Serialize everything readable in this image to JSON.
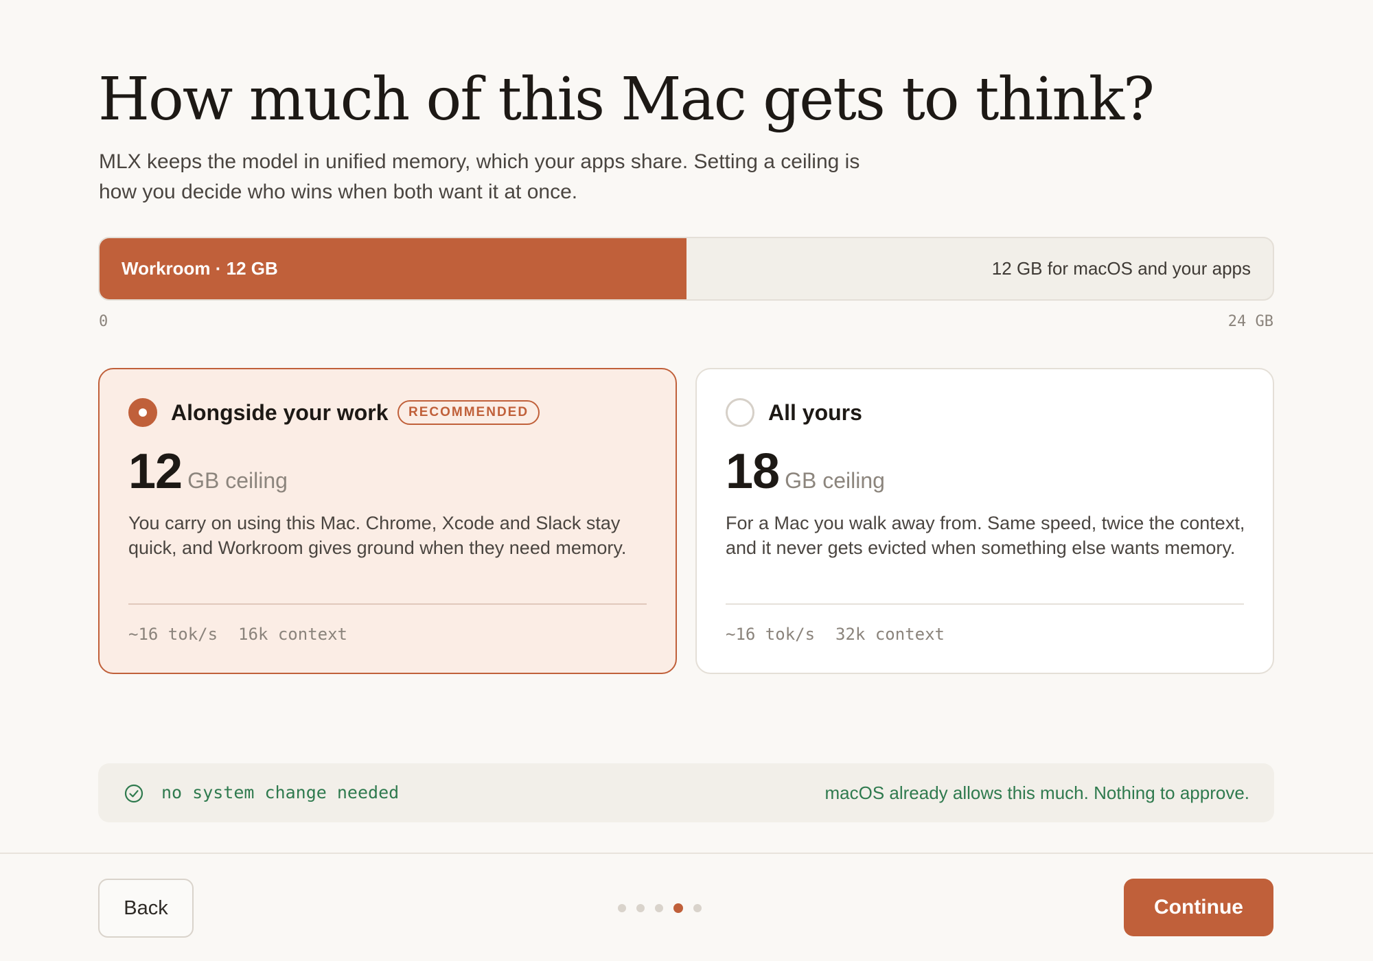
{
  "header": {
    "title": "How much of this Mac gets to think?",
    "subtitle": "MLX keeps the model in unified memory, which your apps share. Setting a ceiling is how you decide who wins when both want it at once."
  },
  "memory_bar": {
    "fill_label": "Workroom · 12 GB",
    "fill_fraction": 0.5,
    "rest_label": "12 GB for macOS and your apps",
    "scale_min": "0",
    "scale_max": "24 GB"
  },
  "options": [
    {
      "title": "Alongside your work",
      "badge": "RECOMMENDED",
      "selected": true,
      "ceiling_value": "12",
      "ceiling_unit": "GB ceiling",
      "description": "You carry on using this Mac. Chrome, Xcode and Slack stay quick, and Workroom gives ground when they need memory.",
      "speed": "~16 tok/s",
      "context": "16k context"
    },
    {
      "title": "All yours",
      "selected": false,
      "ceiling_value": "18",
      "ceiling_unit": "GB ceiling",
      "description": "For a Mac you walk away from. Same speed, twice the context, and it never gets evicted when something else wants memory.",
      "speed": "~16 tok/s",
      "context": "32k context"
    }
  ],
  "notice": {
    "icon": "check-circle-icon",
    "code": "no system change needed",
    "message": "macOS already allows this much. Nothing to approve."
  },
  "footer": {
    "back_label": "Back",
    "continue_label": "Continue",
    "steps_total": 5,
    "steps_current": 4
  },
  "colors": {
    "accent": "#c0603a",
    "success": "#2f7a4e",
    "background": "#faf8f5"
  }
}
